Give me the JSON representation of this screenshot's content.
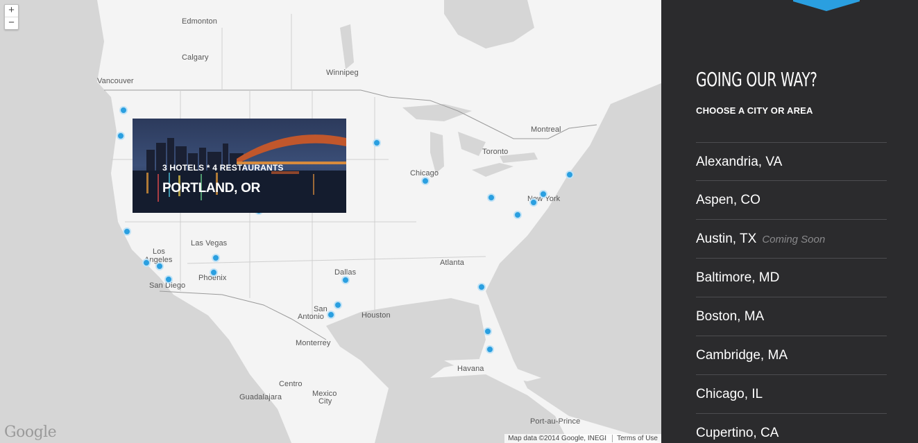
{
  "map": {
    "zoom_in_label": "+",
    "zoom_out_label": "−",
    "google_logo": "Google",
    "attribution": "Map data ©2014 Google, INEGI",
    "terms": "Terms of Use",
    "labels": {
      "edmonton": "Edmonton",
      "calgary": "Calgary",
      "vancouver": "Vancouver",
      "winnipeg": "Winnipeg",
      "montreal": "Montreal",
      "toronto": "Toronto",
      "chicago": "Chicago",
      "new_york": "New York",
      "las_vegas": "Las Vegas",
      "los_angeles_1": "Los",
      "los_angeles_2": "Angeles",
      "phoenix": "Phoenix",
      "san_diego": "San Diego",
      "dallas": "Dallas",
      "atlanta": "Atlanta",
      "san_antonio_1": "San",
      "san_antonio_2": "Antonio",
      "houston": "Houston",
      "monterrey": "Monterrey",
      "havana": "Havana",
      "centro": "Centro",
      "guadalajara": "Guadalajara",
      "mexico_city_1": "Mexico",
      "mexico_city_2": "City",
      "port_au_prince": "Port-au-Prince"
    },
    "colors": {
      "land": "#f4f4f4",
      "water": "#d6d6d6",
      "marker": "#2a9fe0"
    }
  },
  "popup": {
    "meta": "3 HOTELS * 4 RESTAURANTS",
    "city": "PORTLAND, OR"
  },
  "sidebar": {
    "title": "GOING OUR WAY?",
    "subtitle": "CHOOSE A CITY OR AREA",
    "accent_color": "#2a9fe0",
    "cities": [
      {
        "name": "Alexandria, VA",
        "note": ""
      },
      {
        "name": "Aspen, CO",
        "note": ""
      },
      {
        "name": "Austin, TX",
        "note": "Coming Soon"
      },
      {
        "name": "Baltimore, MD",
        "note": ""
      },
      {
        "name": "Boston, MA",
        "note": ""
      },
      {
        "name": "Cambridge, MA",
        "note": ""
      },
      {
        "name": "Chicago, IL",
        "note": ""
      },
      {
        "name": "Cupertino, CA",
        "note": ""
      }
    ]
  }
}
